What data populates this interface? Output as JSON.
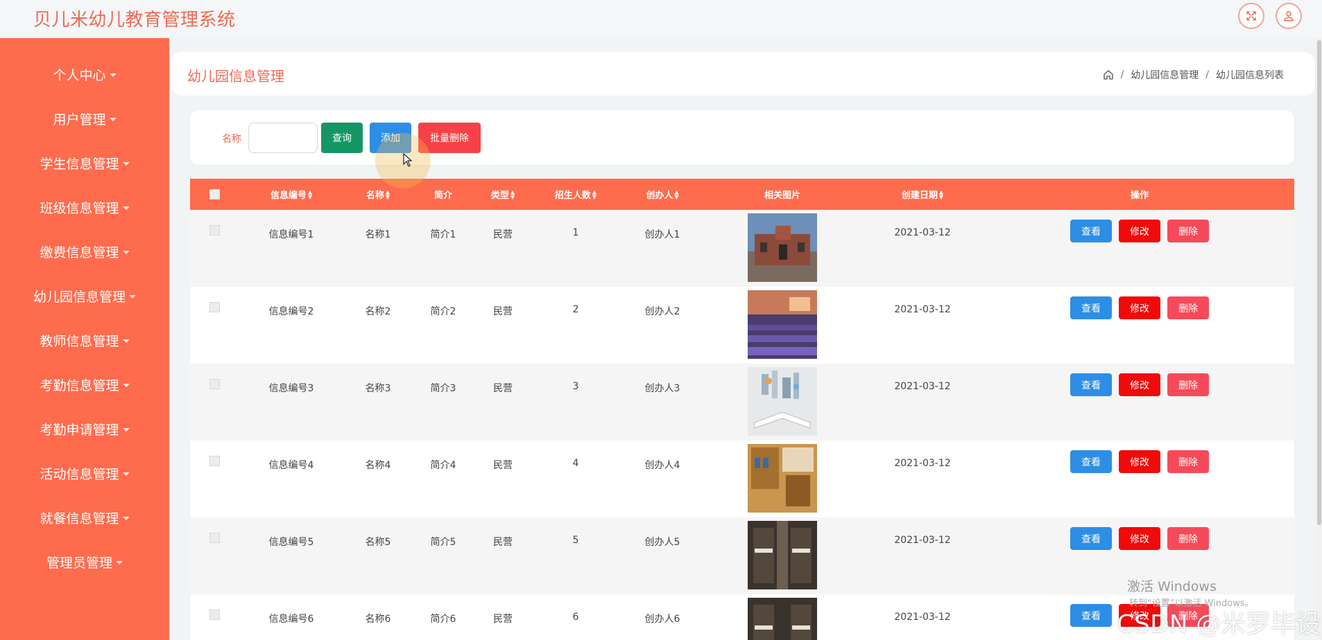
{
  "app": {
    "title": "贝儿米幼儿教育管理系统"
  },
  "topbar": {
    "fullscreen_icon": "fullscreen-icon",
    "user_icon": "user-icon"
  },
  "sidebar": {
    "items": [
      {
        "label": "个人中心"
      },
      {
        "label": "用户管理"
      },
      {
        "label": "学生信息管理"
      },
      {
        "label": "班级信息管理"
      },
      {
        "label": "缴费信息管理"
      },
      {
        "label": "幼儿园信息管理"
      },
      {
        "label": "教师信息管理"
      },
      {
        "label": "考勤信息管理"
      },
      {
        "label": "考勤申请管理"
      },
      {
        "label": "活动信息管理"
      },
      {
        "label": "就餐信息管理"
      },
      {
        "label": "管理员管理"
      }
    ]
  },
  "header": {
    "title": "幼儿园信息管理",
    "breadcrumb": [
      "幼儿园信息管理",
      "幼儿园信息列表"
    ]
  },
  "search": {
    "label": "名称",
    "value": "",
    "search_button": "查询",
    "add_button": "添加",
    "batch_delete_button": "批量删除"
  },
  "table": {
    "columns": [
      "信息编号",
      "名称",
      "简介",
      "类型",
      "招生人数",
      "创办人",
      "相关图片",
      "创建日期",
      "操作"
    ],
    "rows": [
      {
        "code": "信息编号1",
        "name": "名称1",
        "intro": "简介1",
        "type": "民营",
        "enroll": "1",
        "founder": "创办人1",
        "date": "2021-03-12"
      },
      {
        "code": "信息编号2",
        "name": "名称2",
        "intro": "简介2",
        "type": "民营",
        "enroll": "2",
        "founder": "创办人2",
        "date": "2021-03-12"
      },
      {
        "code": "信息编号3",
        "name": "名称3",
        "intro": "简介3",
        "type": "民营",
        "enroll": "3",
        "founder": "创办人3",
        "date": "2021-03-12"
      },
      {
        "code": "信息编号4",
        "name": "名称4",
        "intro": "简介4",
        "type": "民营",
        "enroll": "4",
        "founder": "创办人4",
        "date": "2021-03-12"
      },
      {
        "code": "信息编号5",
        "name": "名称5",
        "intro": "简介5",
        "type": "民营",
        "enroll": "5",
        "founder": "创办人5",
        "date": "2021-03-12"
      },
      {
        "code": "信息编号6",
        "name": "名称6",
        "intro": "简介6",
        "type": "民营",
        "enroll": "6",
        "founder": "创办人6",
        "date": "2021-03-12"
      }
    ],
    "actions": {
      "view": "查看",
      "edit": "修改",
      "delete": "删除"
    }
  },
  "overlay": {
    "activate_windows": "激活 Windows",
    "activate_windows_hint": "转到“设置”以激活 Windows。",
    "csdn_watermark": "CSDN @米罗毕设"
  },
  "colors": {
    "accent": "#ff6b4d",
    "title": "#ef6a55",
    "search_button": "#159765",
    "add_button": "#2d8ee6",
    "batch_delete_button": "#f64246",
    "edit_button": "#f00a0a",
    "delete_button": "#f64a5a"
  }
}
